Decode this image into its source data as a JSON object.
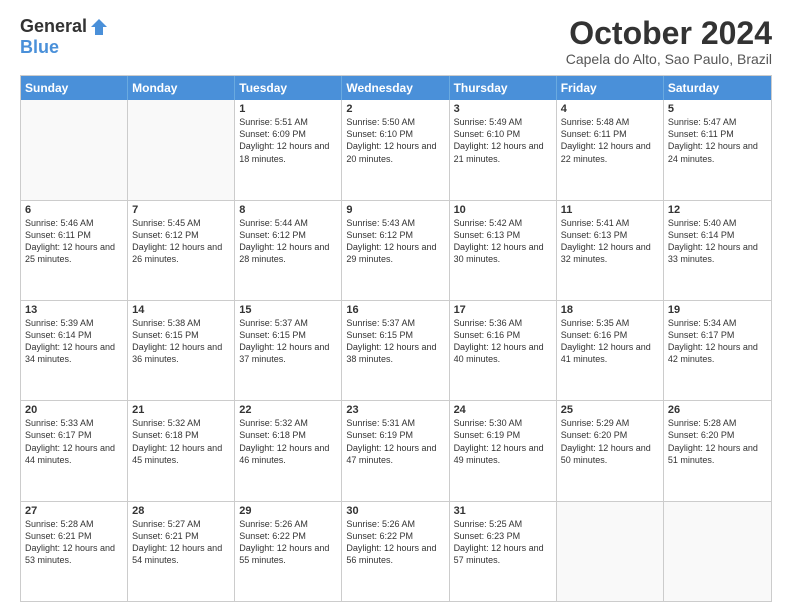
{
  "header": {
    "logo": {
      "general": "General",
      "blue": "Blue"
    },
    "title": "October 2024",
    "location": "Capela do Alto, Sao Paulo, Brazil"
  },
  "calendar": {
    "days_of_week": [
      "Sunday",
      "Monday",
      "Tuesday",
      "Wednesday",
      "Thursday",
      "Friday",
      "Saturday"
    ],
    "rows": [
      [
        {
          "day": "",
          "empty": true
        },
        {
          "day": "",
          "empty": true
        },
        {
          "day": "1",
          "sunrise": "Sunrise: 5:51 AM",
          "sunset": "Sunset: 6:09 PM",
          "daylight": "Daylight: 12 hours and 18 minutes."
        },
        {
          "day": "2",
          "sunrise": "Sunrise: 5:50 AM",
          "sunset": "Sunset: 6:10 PM",
          "daylight": "Daylight: 12 hours and 20 minutes."
        },
        {
          "day": "3",
          "sunrise": "Sunrise: 5:49 AM",
          "sunset": "Sunset: 6:10 PM",
          "daylight": "Daylight: 12 hours and 21 minutes."
        },
        {
          "day": "4",
          "sunrise": "Sunrise: 5:48 AM",
          "sunset": "Sunset: 6:11 PM",
          "daylight": "Daylight: 12 hours and 22 minutes."
        },
        {
          "day": "5",
          "sunrise": "Sunrise: 5:47 AM",
          "sunset": "Sunset: 6:11 PM",
          "daylight": "Daylight: 12 hours and 24 minutes."
        }
      ],
      [
        {
          "day": "6",
          "sunrise": "Sunrise: 5:46 AM",
          "sunset": "Sunset: 6:11 PM",
          "daylight": "Daylight: 12 hours and 25 minutes."
        },
        {
          "day": "7",
          "sunrise": "Sunrise: 5:45 AM",
          "sunset": "Sunset: 6:12 PM",
          "daylight": "Daylight: 12 hours and 26 minutes."
        },
        {
          "day": "8",
          "sunrise": "Sunrise: 5:44 AM",
          "sunset": "Sunset: 6:12 PM",
          "daylight": "Daylight: 12 hours and 28 minutes."
        },
        {
          "day": "9",
          "sunrise": "Sunrise: 5:43 AM",
          "sunset": "Sunset: 6:12 PM",
          "daylight": "Daylight: 12 hours and 29 minutes."
        },
        {
          "day": "10",
          "sunrise": "Sunrise: 5:42 AM",
          "sunset": "Sunset: 6:13 PM",
          "daylight": "Daylight: 12 hours and 30 minutes."
        },
        {
          "day": "11",
          "sunrise": "Sunrise: 5:41 AM",
          "sunset": "Sunset: 6:13 PM",
          "daylight": "Daylight: 12 hours and 32 minutes."
        },
        {
          "day": "12",
          "sunrise": "Sunrise: 5:40 AM",
          "sunset": "Sunset: 6:14 PM",
          "daylight": "Daylight: 12 hours and 33 minutes."
        }
      ],
      [
        {
          "day": "13",
          "sunrise": "Sunrise: 5:39 AM",
          "sunset": "Sunset: 6:14 PM",
          "daylight": "Daylight: 12 hours and 34 minutes."
        },
        {
          "day": "14",
          "sunrise": "Sunrise: 5:38 AM",
          "sunset": "Sunset: 6:15 PM",
          "daylight": "Daylight: 12 hours and 36 minutes."
        },
        {
          "day": "15",
          "sunrise": "Sunrise: 5:37 AM",
          "sunset": "Sunset: 6:15 PM",
          "daylight": "Daylight: 12 hours and 37 minutes."
        },
        {
          "day": "16",
          "sunrise": "Sunrise: 5:37 AM",
          "sunset": "Sunset: 6:15 PM",
          "daylight": "Daylight: 12 hours and 38 minutes."
        },
        {
          "day": "17",
          "sunrise": "Sunrise: 5:36 AM",
          "sunset": "Sunset: 6:16 PM",
          "daylight": "Daylight: 12 hours and 40 minutes."
        },
        {
          "day": "18",
          "sunrise": "Sunrise: 5:35 AM",
          "sunset": "Sunset: 6:16 PM",
          "daylight": "Daylight: 12 hours and 41 minutes."
        },
        {
          "day": "19",
          "sunrise": "Sunrise: 5:34 AM",
          "sunset": "Sunset: 6:17 PM",
          "daylight": "Daylight: 12 hours and 42 minutes."
        }
      ],
      [
        {
          "day": "20",
          "sunrise": "Sunrise: 5:33 AM",
          "sunset": "Sunset: 6:17 PM",
          "daylight": "Daylight: 12 hours and 44 minutes."
        },
        {
          "day": "21",
          "sunrise": "Sunrise: 5:32 AM",
          "sunset": "Sunset: 6:18 PM",
          "daylight": "Daylight: 12 hours and 45 minutes."
        },
        {
          "day": "22",
          "sunrise": "Sunrise: 5:32 AM",
          "sunset": "Sunset: 6:18 PM",
          "daylight": "Daylight: 12 hours and 46 minutes."
        },
        {
          "day": "23",
          "sunrise": "Sunrise: 5:31 AM",
          "sunset": "Sunset: 6:19 PM",
          "daylight": "Daylight: 12 hours and 47 minutes."
        },
        {
          "day": "24",
          "sunrise": "Sunrise: 5:30 AM",
          "sunset": "Sunset: 6:19 PM",
          "daylight": "Daylight: 12 hours and 49 minutes."
        },
        {
          "day": "25",
          "sunrise": "Sunrise: 5:29 AM",
          "sunset": "Sunset: 6:20 PM",
          "daylight": "Daylight: 12 hours and 50 minutes."
        },
        {
          "day": "26",
          "sunrise": "Sunrise: 5:28 AM",
          "sunset": "Sunset: 6:20 PM",
          "daylight": "Daylight: 12 hours and 51 minutes."
        }
      ],
      [
        {
          "day": "27",
          "sunrise": "Sunrise: 5:28 AM",
          "sunset": "Sunset: 6:21 PM",
          "daylight": "Daylight: 12 hours and 53 minutes."
        },
        {
          "day": "28",
          "sunrise": "Sunrise: 5:27 AM",
          "sunset": "Sunset: 6:21 PM",
          "daylight": "Daylight: 12 hours and 54 minutes."
        },
        {
          "day": "29",
          "sunrise": "Sunrise: 5:26 AM",
          "sunset": "Sunset: 6:22 PM",
          "daylight": "Daylight: 12 hours and 55 minutes."
        },
        {
          "day": "30",
          "sunrise": "Sunrise: 5:26 AM",
          "sunset": "Sunset: 6:22 PM",
          "daylight": "Daylight: 12 hours and 56 minutes."
        },
        {
          "day": "31",
          "sunrise": "Sunrise: 5:25 AM",
          "sunset": "Sunset: 6:23 PM",
          "daylight": "Daylight: 12 hours and 57 minutes."
        },
        {
          "day": "",
          "empty": true
        },
        {
          "day": "",
          "empty": true
        }
      ]
    ]
  }
}
